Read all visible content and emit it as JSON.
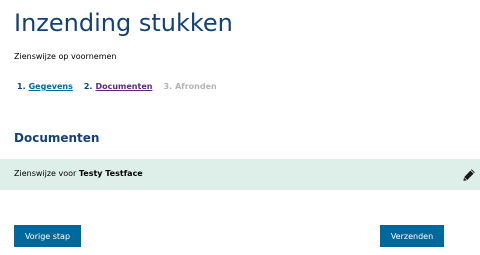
{
  "header": {
    "title": "Inzending stukken",
    "subtitle": "Zienswijze op voornemen"
  },
  "steps": [
    {
      "number": "1.",
      "label": "Gegevens",
      "state": "completed"
    },
    {
      "number": "2.",
      "label": "Documenten",
      "state": "current"
    },
    {
      "number": "3.",
      "label": "Afronden",
      "state": "disabled"
    }
  ],
  "section": {
    "title": "Documenten"
  },
  "document": {
    "prefix": "Zienswijze voor",
    "name": "Testy Testface",
    "edit_icon": "pencil-icon"
  },
  "buttons": {
    "previous": "Vorige stap",
    "submit": "Verzenden"
  },
  "colors": {
    "title": "#154273",
    "link": "#01689b",
    "visited_link": "#5b2a7a",
    "disabled": "#b4b4b4",
    "row_background": "#ddefe8",
    "button": "#01689b"
  }
}
